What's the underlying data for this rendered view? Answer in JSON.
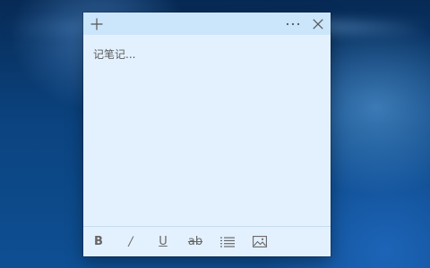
{
  "note": {
    "placeholder": "记笔记..."
  },
  "header": {
    "add_icon": "plus-icon",
    "more_icon": "more-horizontal-icon",
    "close_icon": "close-icon"
  },
  "toolbar": {
    "bold": "B",
    "italic": "/",
    "underline": "U",
    "strikethrough": "ab",
    "list_icon": "bullet-list-icon",
    "image_icon": "image-icon"
  },
  "colors": {
    "note_background": "#e3f1fe",
    "header_background": "#cbe5fb",
    "icon_gray": "#666666"
  }
}
